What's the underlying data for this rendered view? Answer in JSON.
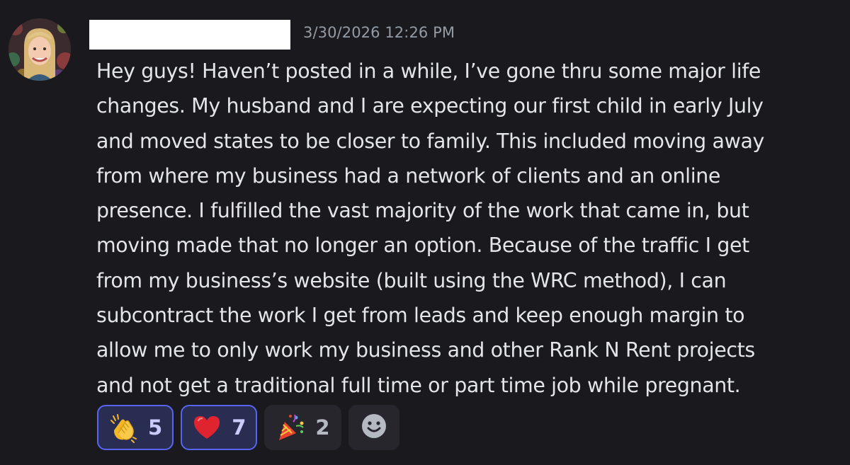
{
  "message": {
    "timestamp": "3/30/2026 12:26 PM",
    "content": "Hey guys! Haven’t posted in a while, I’ve gone thru some major life\nchanges. My husband and I are expecting our first child in early July\nand moved states to be closer to family. This included moving away\nfrom where my business had a network of clients and an online\npresence. I fulfilled the vast majority of the work that came in, but\nmoving made that no longer an option. Because of the traffic I get\nfrom my business’s website (built using the WRC method), I can\nsubcontract the work I get from leads and keep enough margin to\nallow me to only work my business and other Rank N Rent projects\nand not get a traditional full time or part time job while pregnant."
  },
  "reactions": [
    {
      "emoji": "clapping-hands-icon",
      "count": "5",
      "active": true
    },
    {
      "emoji": "red-heart-icon",
      "count": "7",
      "active": true
    },
    {
      "emoji": "party-popper-icon",
      "count": "2",
      "active": false
    }
  ],
  "add_reaction": {
    "icon": "smiley-add-reaction-icon"
  },
  "colors": {
    "background": "#1a1a1e",
    "text": "#e3e5e8",
    "timestamp": "#949ba4",
    "active_reaction_border": "#5865f2",
    "active_reaction_bg": "#2a2d52"
  }
}
